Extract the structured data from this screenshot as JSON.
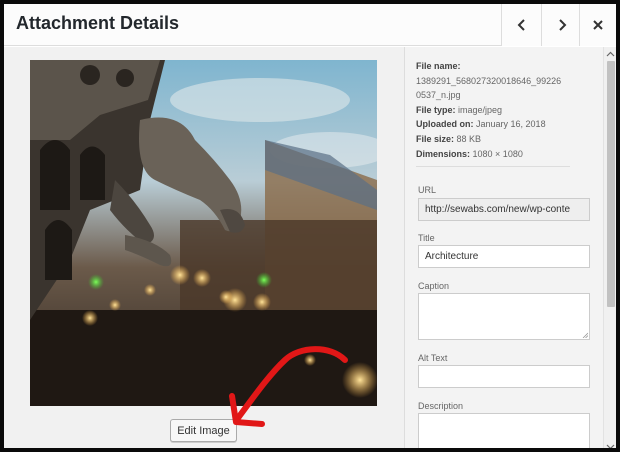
{
  "header": {
    "title": "Attachment Details",
    "prev_icon": "chevron-left-icon",
    "next_icon": "chevron-right-icon",
    "close_icon": "close-icon"
  },
  "media": {
    "edit_button_label": "Edit Image"
  },
  "details": {
    "file_name_label": "File name:",
    "file_name_value": "1389291_568027320018646_992260537_n.jpg",
    "file_type_label": "File type:",
    "file_type_value": "image/jpeg",
    "uploaded_label": "Uploaded on:",
    "uploaded_value": "January 16, 2018",
    "file_size_label": "File size:",
    "file_size_value": "88 KB",
    "dimensions_label": "Dimensions:",
    "dimensions_value": "1080 × 1080"
  },
  "fields": {
    "url_label": "URL",
    "url_value": "http://sewabs.com/new/wp-conte",
    "title_label": "Title",
    "title_value": "Architecture",
    "caption_label": "Caption",
    "caption_value": "",
    "alt_label": "Alt Text",
    "alt_value": "",
    "description_label": "Description",
    "description_value": ""
  },
  "colors": {
    "annotation_arrow": "#e11717"
  }
}
